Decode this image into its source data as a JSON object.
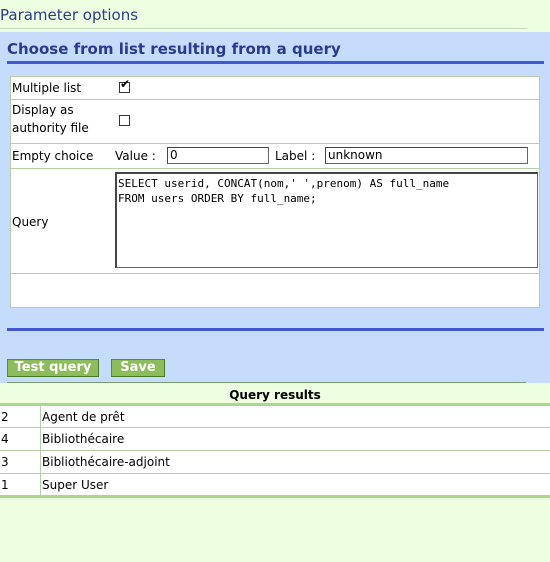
{
  "page": {
    "title": "Parameter options"
  },
  "panel": {
    "title": "Choose from list resulting from a query"
  },
  "form": {
    "multiple_list": {
      "label": "Multiple list",
      "checked": true,
      "mark": "✔"
    },
    "authority_file": {
      "label_line1": "Display as",
      "label_line2": "authority file",
      "checked": false
    },
    "empty_choice": {
      "label": "Empty choice",
      "value_label": "Value :",
      "value": "0",
      "label_label": "Label :",
      "label_value": "unknown"
    },
    "query": {
      "label": "Query",
      "text": "SELECT userid, CONCAT(nom,' ',prenom) AS full_name\nFROM users ORDER BY full_name;"
    }
  },
  "buttons": {
    "test_query": "Test query",
    "save": "Save"
  },
  "results": {
    "title": "Query results",
    "rows": [
      {
        "id": "2",
        "name": "Agent de prêt"
      },
      {
        "id": "4",
        "name": "Bibliothécaire"
      },
      {
        "id": "3",
        "name": "Bibliothécaire-adjoint"
      },
      {
        "id": "1",
        "name": "Super User"
      }
    ]
  },
  "colors": {
    "page_background": "#eefee0",
    "panel_background": "#c6dcfc",
    "title_color": "#2b3b8c",
    "rule_color": "#4356d4",
    "button_green": "#8cbc5c"
  }
}
